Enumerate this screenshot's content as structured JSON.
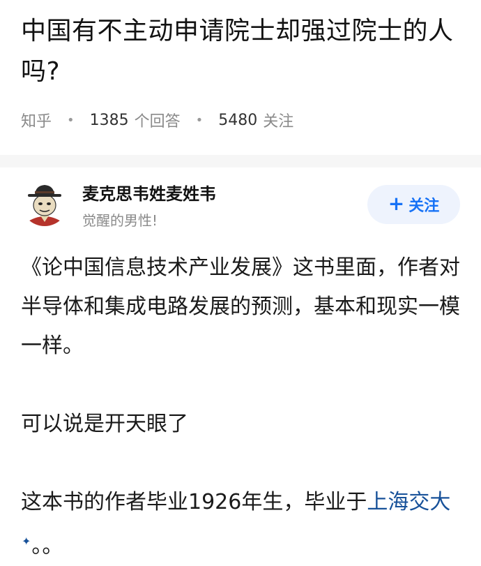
{
  "question": {
    "title": "中国有不主动申请院士却强过院士的人吗?",
    "source": "知乎",
    "answers_count": "1385",
    "answers_label": "个回答",
    "followers_count": "5480",
    "followers_label": "关注"
  },
  "author": {
    "name": "麦克思韦姓麦姓韦",
    "bio": "觉醒的男性!",
    "follow_label": "关注"
  },
  "answer": {
    "p1": "《论中国信息技术产业发展》这书里面，作者对半导体和集成电路发展的预测，基本和现实一模一样。",
    "p2": "可以说是开天眼了",
    "p3_text": "这本书的作者毕业1926年生，毕业于",
    "p3_link": "上海交大",
    "p3_tail": "。。"
  },
  "colors": {
    "accent": "#1772f6",
    "link": "#175199",
    "meta": "#8a8a8a"
  }
}
